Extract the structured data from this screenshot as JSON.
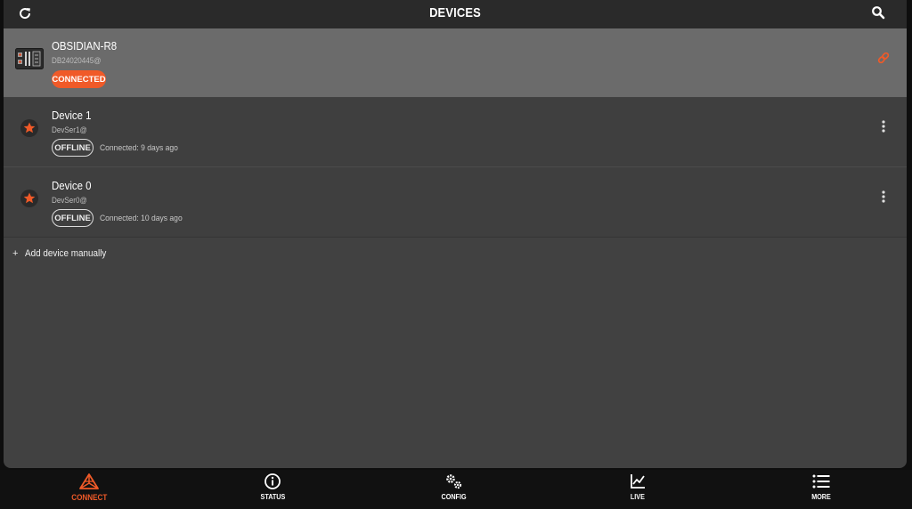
{
  "header": {
    "title": "DEVICES"
  },
  "devices": [
    {
      "name": "OBSIDIAN-R8",
      "serial": "DB24020445@",
      "status": "CONNECTED",
      "last_connected": ""
    },
    {
      "name": "Device 1",
      "serial": "DevSer1@",
      "status": "OFFLINE",
      "last_connected": "Connected: 9 days ago"
    },
    {
      "name": "Device 0",
      "serial": "DevSer0@",
      "status": "OFFLINE",
      "last_connected": "Connected: 10 days ago"
    }
  ],
  "add_device": {
    "plus": "+",
    "label": "Add device manually"
  },
  "nav": [
    {
      "label": "CONNECT",
      "icon": "connect-icon",
      "active": true
    },
    {
      "label": "STATUS",
      "icon": "info-icon",
      "active": false
    },
    {
      "label": "CONFIG",
      "icon": "gears-icon",
      "active": false
    },
    {
      "label": "LIVE",
      "icon": "chart-icon",
      "active": false
    },
    {
      "label": "MORE",
      "icon": "list-icon",
      "active": false
    }
  ],
  "colors": {
    "accent": "#f05a28",
    "topbar": "#2a2a2a",
    "background": "#414141",
    "active_row": "#6b6b6b",
    "bottombar": "#111111"
  }
}
